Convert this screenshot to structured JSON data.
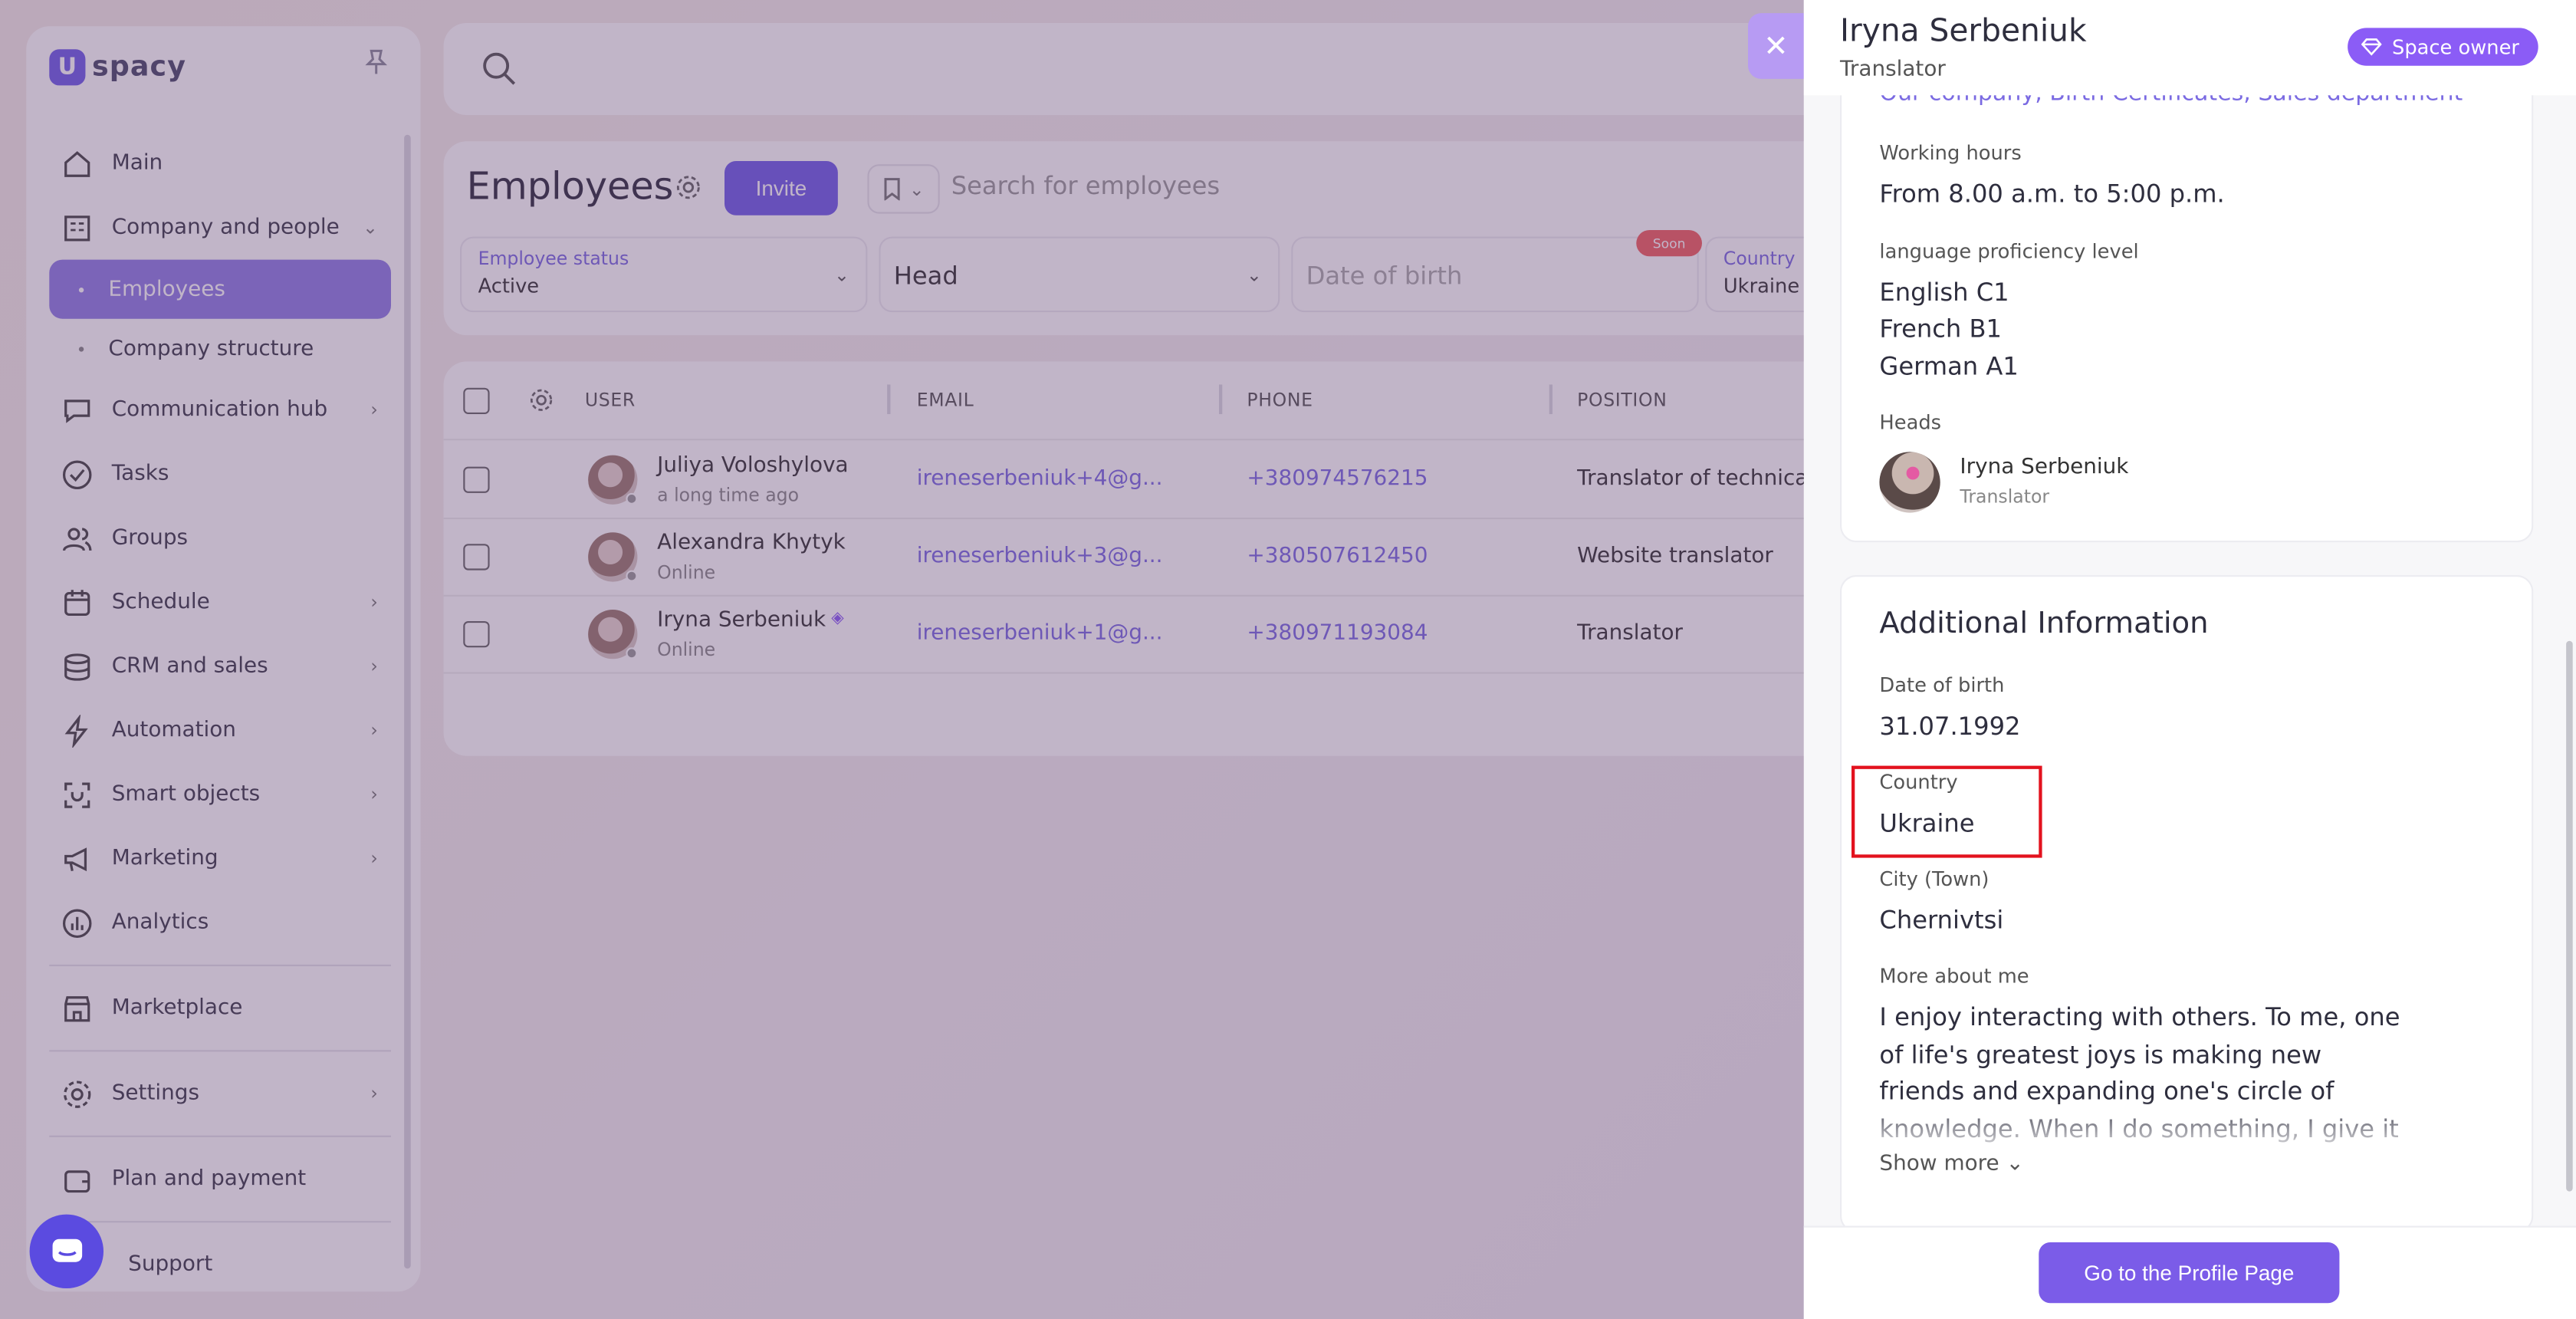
{
  "app": {
    "logo_text": "spacy"
  },
  "sidebar": {
    "items": [
      {
        "label": "Main",
        "icon": "home-icon"
      },
      {
        "label": "Company and people",
        "icon": "building-icon"
      },
      {
        "label": "Employees"
      },
      {
        "label": "Company structure"
      },
      {
        "label": "Communication hub",
        "icon": "chat-icon"
      },
      {
        "label": "Tasks",
        "icon": "check-circle-icon"
      },
      {
        "label": "Groups",
        "icon": "users-icon"
      },
      {
        "label": "Schedule",
        "icon": "calendar-icon"
      },
      {
        "label": "CRM and sales",
        "icon": "database-icon"
      },
      {
        "label": "Automation",
        "icon": "lightning-icon"
      },
      {
        "label": "Smart objects",
        "icon": "scan-icon"
      },
      {
        "label": "Marketing",
        "icon": "megaphone-icon"
      },
      {
        "label": "Analytics",
        "icon": "chart-icon"
      },
      {
        "label": "Marketplace",
        "icon": "store-icon"
      },
      {
        "label": "Settings",
        "icon": "gear-icon"
      },
      {
        "label": "Plan and payment",
        "icon": "wallet-icon"
      },
      {
        "label": "Support",
        "icon": "support-icon"
      }
    ]
  },
  "employees": {
    "title": "Employees",
    "invite_label": "Invite",
    "search_placeholder": "Search for employees",
    "filters": {
      "status_label": "Employee status",
      "status_value": "Active",
      "head_value": "Head",
      "dob_placeholder": "Date of birth",
      "soon_badge": "Soon",
      "country_label": "Country",
      "country_value": "Ukraine"
    },
    "columns": [
      "USER",
      "EMAIL",
      "PHONE",
      "POSITION"
    ],
    "rows": [
      {
        "name": "Juliya Voloshylova",
        "status": "a long time ago",
        "email": "ireneserbeniuk+4@g...",
        "phone": "+380974576215",
        "position": "Translator of technica"
      },
      {
        "name": "Alexandra Khytyk",
        "status": "Online",
        "email": "ireneserbeniuk+3@g...",
        "phone": "+380507612450",
        "position": "Website translator"
      },
      {
        "name": "Iryna Serbeniuk",
        "status": "Online",
        "email": "ireneserbeniuk+1@g...",
        "phone": "+380971193084",
        "position": "Translator"
      }
    ]
  },
  "panel": {
    "name": "Iryna Serbeniuk",
    "role": "Translator",
    "owner_badge": "Space owner",
    "departments": "Our company, Birth Certificates, Sales department",
    "working_hours_label": "Working hours",
    "working_hours_value": "From 8.00 a.m. to 5:00 p.m.",
    "language_label": "language proficiency level",
    "languages": [
      "English C1",
      "French B1",
      "German A1"
    ],
    "heads_label": "Heads",
    "head_name": "Iryna Serbeniuk",
    "head_role": "Translator",
    "additional_title": "Additional Information",
    "dob_label": "Date of birth",
    "dob_value": "31.07.1992",
    "country_label": "Country",
    "country_value": "Ukraine",
    "city_label": "City (Town)",
    "city_value": "Chernivtsi",
    "about_label": "More about me",
    "about_text": "I enjoy interacting with others. To me, one of life's greatest joys is making new friends and expanding one's circle of knowledge. When I do something, I give it",
    "show_more": "Show more",
    "profile_button": "Go to the Profile Page"
  },
  "colors": {
    "accent": "#7b5ce8",
    "owner_badge": "#8b5cf6",
    "highlight": "#e3121e"
  }
}
